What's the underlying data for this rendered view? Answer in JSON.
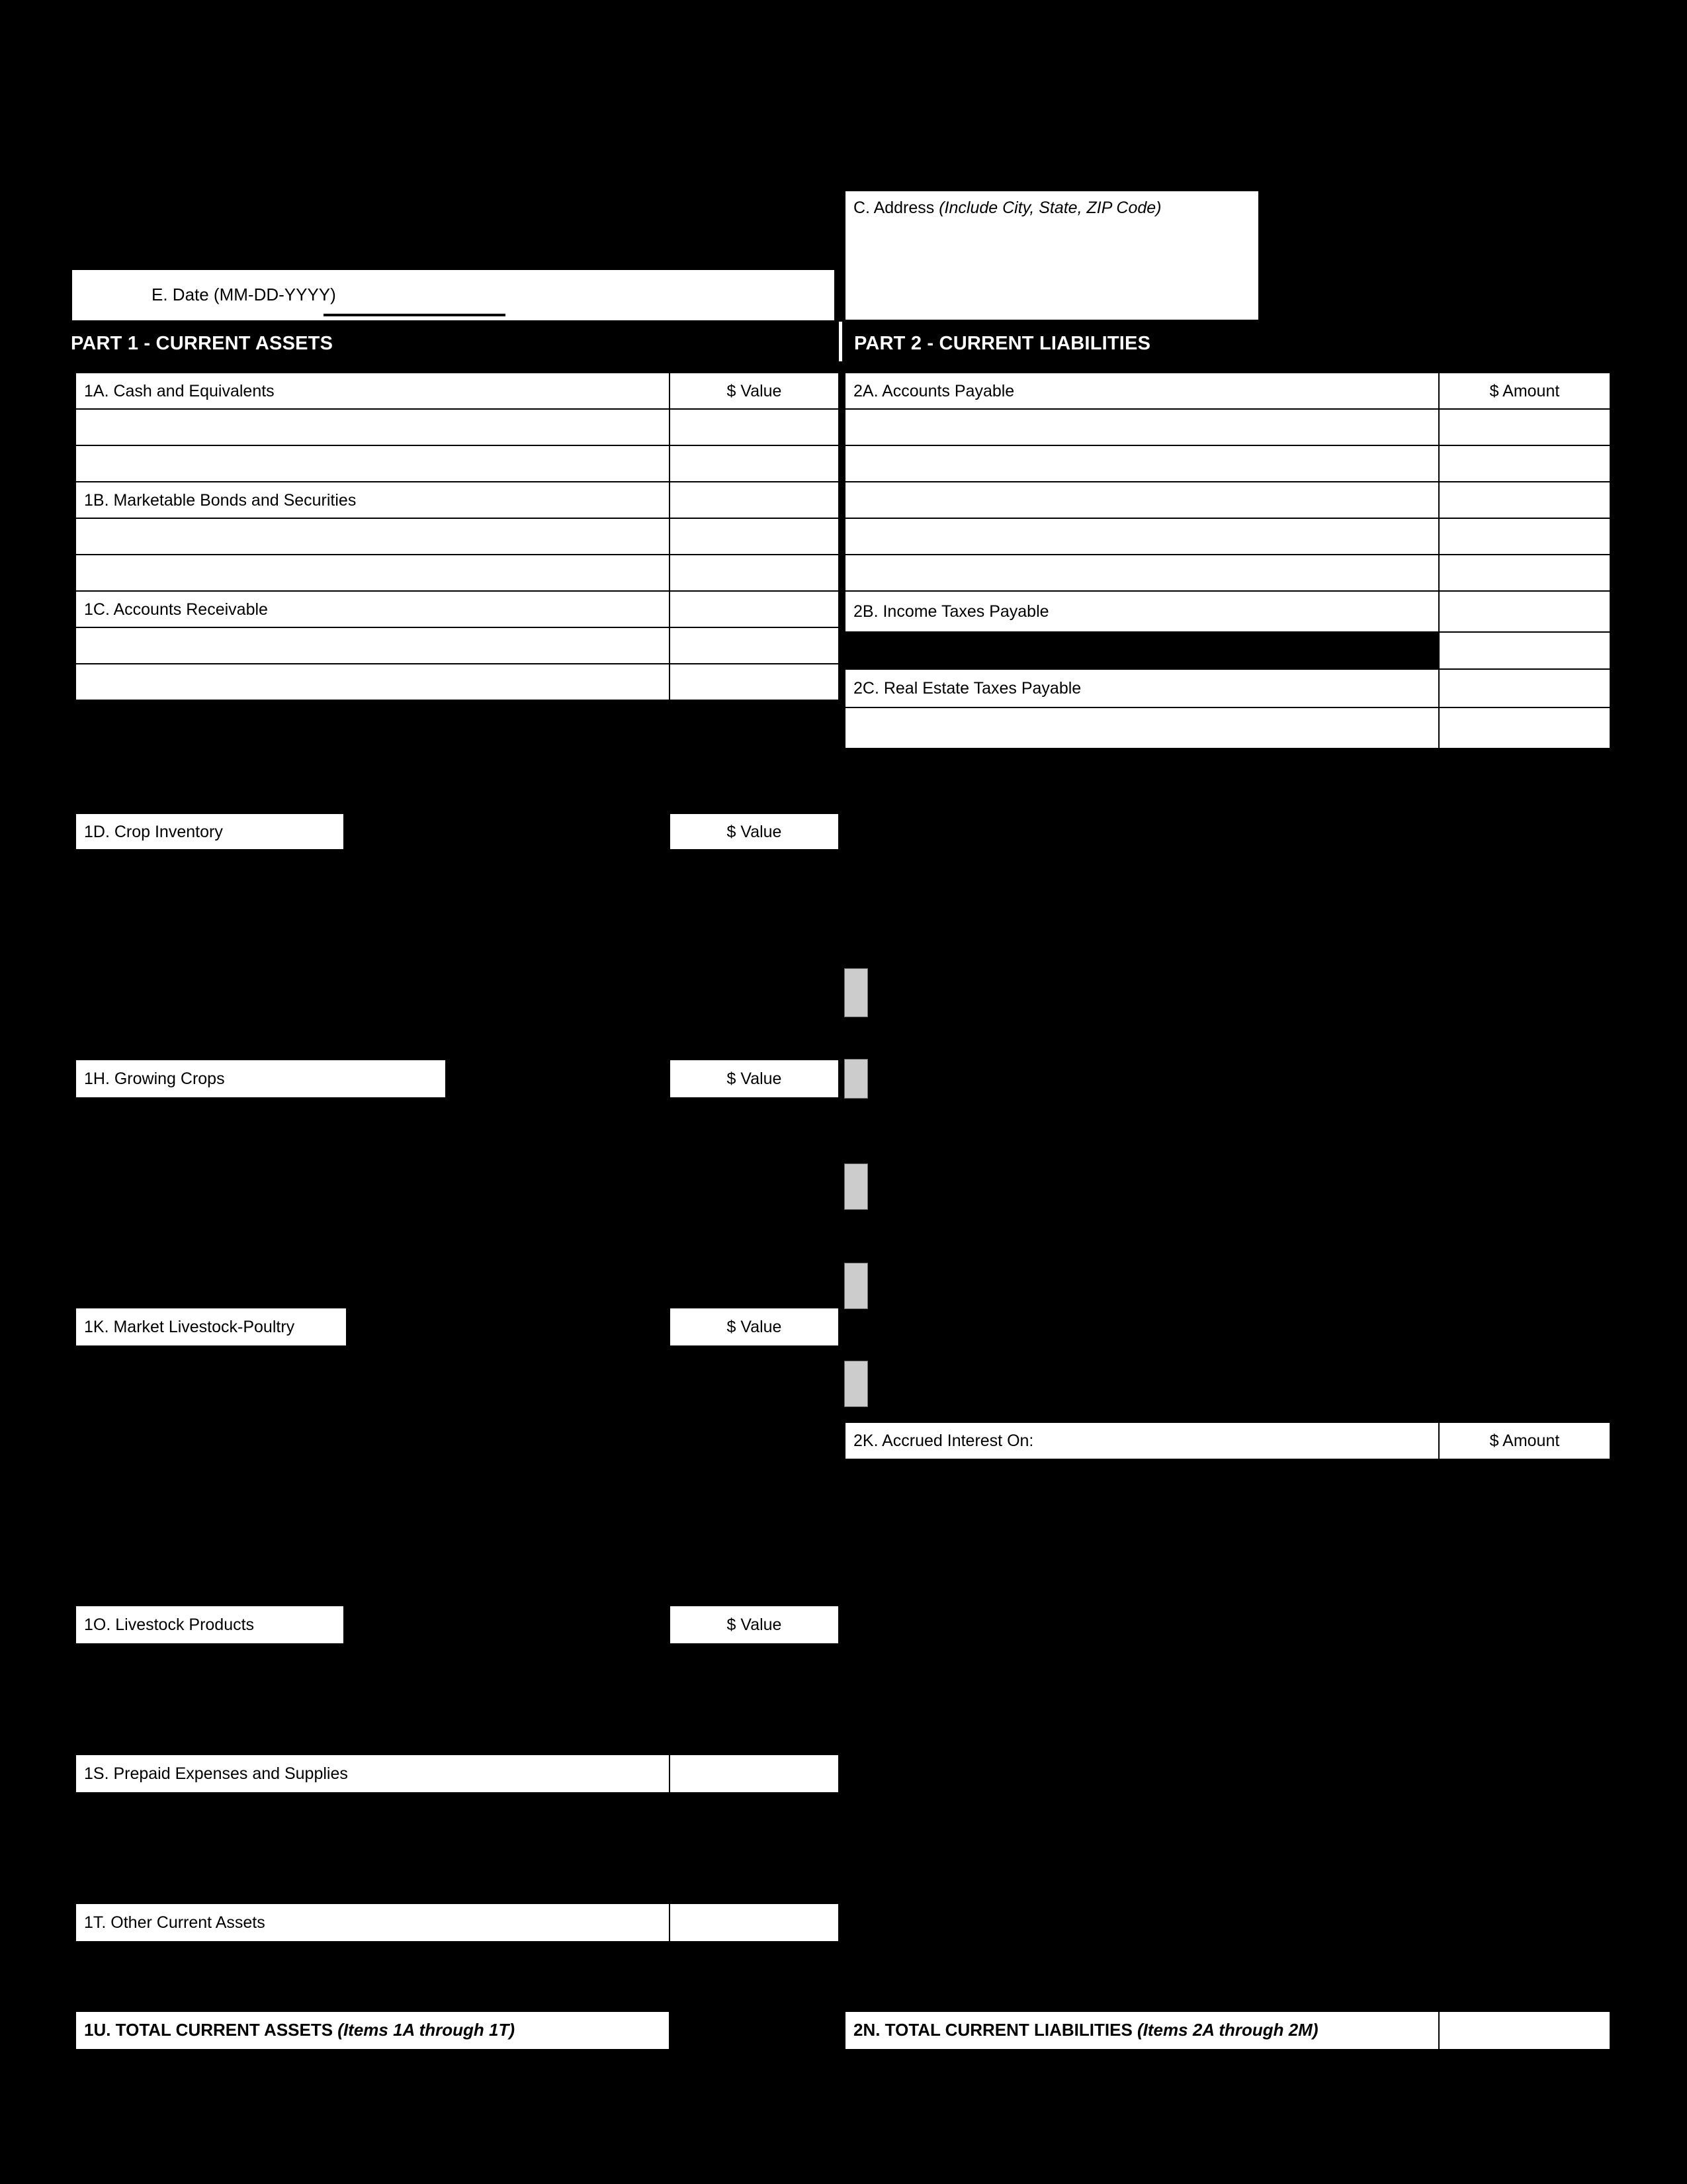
{
  "form": {
    "address_block": {
      "label": "C. Address",
      "hint": "(Include City, State, ZIP Code)"
    },
    "date_block": {
      "label": "E.  Date (MM-DD-YYYY)",
      "value": ""
    }
  },
  "part1": {
    "banner": "PART 1 - CURRENT ASSETS",
    "value_header": "$ Value",
    "rows": [
      {
        "label": "1A.  Cash and Equivalents",
        "value_header": "$ Value"
      },
      {
        "label": "",
        "value": ""
      },
      {
        "label": "",
        "value": ""
      },
      {
        "label": "1B.  Marketable Bonds and Securities",
        "value": ""
      },
      {
        "label": "",
        "value": ""
      },
      {
        "label": "",
        "value": ""
      },
      {
        "label": "1C.  Accounts Receivable",
        "value": ""
      },
      {
        "label": "",
        "value": ""
      },
      {
        "label": "",
        "value": ""
      }
    ],
    "sections": [
      {
        "label": "1D.  Crop Inventory",
        "value_header": "$ Value"
      },
      {
        "label": "1H.  Growing Crops",
        "value_header": "$ Value"
      },
      {
        "label": "1K.  Market Livestock-Poultry",
        "value_header": "$ Value"
      },
      {
        "label": "1O.  Livestock Products",
        "value_header": "$ Value"
      }
    ],
    "wide_rows": [
      {
        "label": "1S.  Prepaid Expenses and Supplies",
        "value": ""
      },
      {
        "label": "1T.  Other Current Assets",
        "value": ""
      }
    ],
    "total": {
      "label": "1U.  TOTAL CURRENT ASSETS ",
      "label_italic": "(Items 1A through 1T)",
      "value": ""
    }
  },
  "part2": {
    "banner": "PART 2 -  CURRENT LIABILITIES",
    "amount_header": "$ Amount",
    "rows": [
      {
        "label": "2A.  Accounts Payable",
        "value_header": "$ Amount"
      },
      {
        "label": "",
        "value": ""
      },
      {
        "label": "",
        "value": ""
      },
      {
        "label": "",
        "value": ""
      },
      {
        "label": "",
        "value": ""
      },
      {
        "label": "",
        "value": ""
      },
      {
        "label": "2B.  Income Taxes Payable",
        "value": ""
      },
      {
        "label": "",
        "value": "",
        "filled": true
      },
      {
        "label": "2C.  Real Estate Taxes Payable",
        "value": ""
      },
      {
        "label": "",
        "value": ""
      }
    ],
    "accrued": {
      "label": "2K.  Accrued Interest On:",
      "value_header": "$ Amount"
    },
    "total": {
      "label": "2N.  TOTAL CURRENT LIABILITIES ",
      "label_italic": "(Items 2A through 2M)",
      "value": ""
    }
  }
}
